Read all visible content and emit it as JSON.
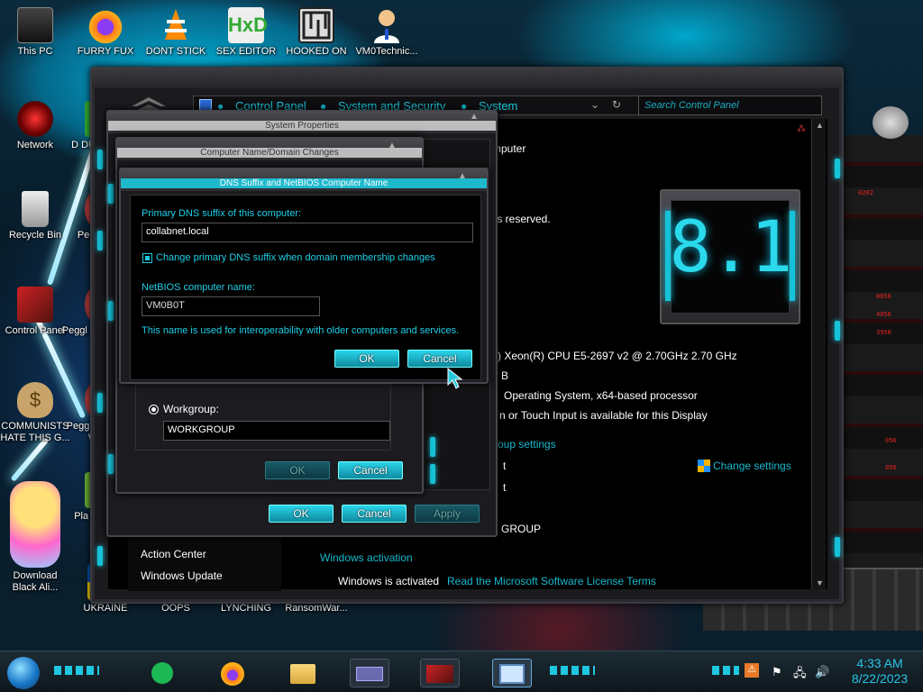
{
  "desktop": {
    "icons": [
      {
        "label": "This PC"
      },
      {
        "label": "FURRY FUX"
      },
      {
        "label": "DONT STICK"
      },
      {
        "label": "SEX EDITOR"
      },
      {
        "label": "HOOKED ON"
      },
      {
        "label": "VM0Technic..."
      },
      {
        "label": "Network"
      },
      {
        "label": "Recycle Bin"
      },
      {
        "label": "Control Panel"
      },
      {
        "label": "COMMUNISTS HATE THIS G..."
      },
      {
        "label": "Download Black Ali..."
      },
      {
        "label": "UKRAINE"
      },
      {
        "label": "OOPS"
      },
      {
        "label": "LYNCHING"
      },
      {
        "label": "RansomWar..."
      },
      {
        "label": "D DU"
      },
      {
        "label": "Peggl"
      },
      {
        "label": "Peggl De"
      },
      {
        "label": "Peggl of Wa"
      },
      {
        "label": "Pla Zo"
      },
      {
        "label": "IN"
      }
    ]
  },
  "control_panel": {
    "breadcrumb": [
      "Control Panel",
      "System and Security",
      "System"
    ],
    "search_placeholder": "Search Control Panel",
    "info": {
      "l1": "mputer",
      "l2": "ts reserved.",
      "cpu": ") Xeon(R) CPU E5-2697 v2 @ 2.70GHz   2.70 GHz",
      "ram": "B",
      "systype": "Operating System, x64-based processor",
      "pen": "n or Touch Input is available for this Display",
      "group_settings": "oup settings",
      "change_settings": "Change settings",
      "t1": "t",
      "t2": "t",
      "workgroup_tail": "GROUP",
      "activation_header": "Windows activation",
      "activated": "Windows is activated",
      "license_link": "Read the Microsoft Software License Terms"
    },
    "version_logo": "8.1",
    "left_links": [
      "Action Center",
      "Windows Update"
    ]
  },
  "system_properties": {
    "title": "System Properties",
    "buttons": {
      "ok": "OK",
      "cancel": "Cancel",
      "apply": "Apply"
    }
  },
  "name_changes": {
    "title": "Computer Name/Domain Changes",
    "workgroup_label": "Workgroup:",
    "workgroup_value": "WORKGROUP",
    "buttons": {
      "ok": "OK",
      "cancel": "Cancel"
    }
  },
  "dns_dialog": {
    "title": "DNS Suffix and NetBIOS Computer Name",
    "primary_label": "Primary DNS suffix of this computer:",
    "primary_value": "collabnet.local",
    "checkbox_label": "Change primary DNS suffix when domain membership changes",
    "checkbox_checked": true,
    "netbios_label": "NetBIOS computer name:",
    "netbios_value": "VM0B0T",
    "note": "This name is used for interoperability with older computers and services.",
    "buttons": {
      "ok": "OK",
      "cancel": "Cancel"
    }
  },
  "taskbar": {
    "time": "4:33 AM",
    "date": "8/22/2023"
  },
  "colors": {
    "accent": "#1ec9de",
    "link": "#18b9cf",
    "clock": "#27c4e6"
  }
}
